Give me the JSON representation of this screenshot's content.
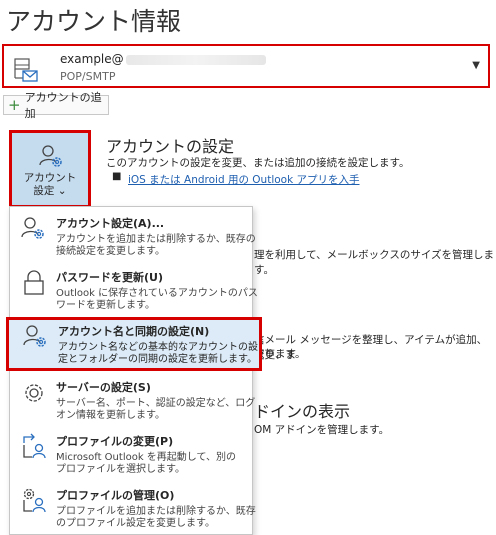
{
  "page": {
    "title": "アカウント情報"
  },
  "account": {
    "email_prefix": "example@",
    "type": "POP/SMTP"
  },
  "add_account": {
    "label": "アカウントの追加"
  },
  "account_settings_button": {
    "line1": "アカウント",
    "line2": "設定 ⌄"
  },
  "account_settings_section": {
    "title": "アカウントの設定",
    "description": "このアカウントの設定を変更、または追加の接続を設定します。",
    "bullet": "■",
    "link": "iOS または Android 用の Outlook アプリを入手"
  },
  "background_fragments": {
    "mailbox": "理を利用して、メールボックスのサイズを管理します。",
    "rules1": "信メール メッセージを整理し、アイテムが追加、変更、ま",
    "rules2": "取ります。",
    "addins_title": "ドインの表示",
    "addins_desc": "OM アドインを管理します。"
  },
  "menu": {
    "items": [
      {
        "title": "アカウント設定(A)...",
        "desc1": "アカウントを追加または削除するか、既存の",
        "desc2": "接続設定を変更します。",
        "icon": "account-gear-icon"
      },
      {
        "title": "パスワードを更新(U)",
        "desc1": "Outlook に保存されているアカウントのパス",
        "desc2": "ワードを更新します。",
        "icon": "lock-icon"
      },
      {
        "title": "アカウント名と同期の設定(N)",
        "desc1": "アカウント名などの基本的なアカウントの設",
        "desc2": "定とフォルダーの同期の設定を更新します。",
        "icon": "account-gear-icon"
      },
      {
        "title": "サーバーの設定(S)",
        "desc1": "サーバー名、ポート、認証の設定など、ログ",
        "desc2": "オン情報を更新します。",
        "icon": "gear-icon"
      },
      {
        "title": "プロファイルの変更(P)",
        "desc1": "Microsoft Outlook を再起動して、別の",
        "desc2": "プロファイルを選択します。",
        "icon": "profile-switch-icon"
      },
      {
        "title": "プロファイルの管理(O)",
        "desc1": "プロファイルを追加または削除するか、既存",
        "desc2": "のプロファイル設定を変更します。",
        "icon": "profile-manage-icon"
      }
    ]
  },
  "colors": {
    "highlight_border": "#d70000",
    "button_bg": "#c5dcef",
    "link": "#1f5fb0"
  }
}
